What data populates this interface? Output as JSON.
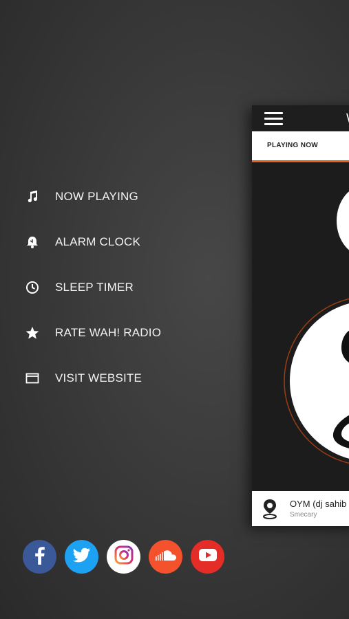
{
  "menu": {
    "items": [
      {
        "label": "NOW PLAYING",
        "icon": "music-note-icon"
      },
      {
        "label": "ALARM CLOCK",
        "icon": "alarm-bell-icon"
      },
      {
        "label": "SLEEP TIMER",
        "icon": "clock-icon"
      },
      {
        "label": "RATE WAH! RADIO",
        "icon": "star-icon"
      },
      {
        "label": "VISIT WEBSITE",
        "icon": "browser-window-icon"
      }
    ]
  },
  "social": [
    {
      "name": "facebook",
      "color": "#3b5998"
    },
    {
      "name": "twitter",
      "color": "#1da1f2"
    },
    {
      "name": "instagram",
      "color": "#ffffff"
    },
    {
      "name": "soundcloud",
      "color": "#f3522d"
    },
    {
      "name": "youtube",
      "color": "#e52d27"
    }
  ],
  "preview": {
    "title_fragment": "W",
    "tab_label": "PLAYING NOW",
    "tab_accent": "#e2611d",
    "track_title": "OYM (dj sahib",
    "track_artist": "Smecary"
  }
}
